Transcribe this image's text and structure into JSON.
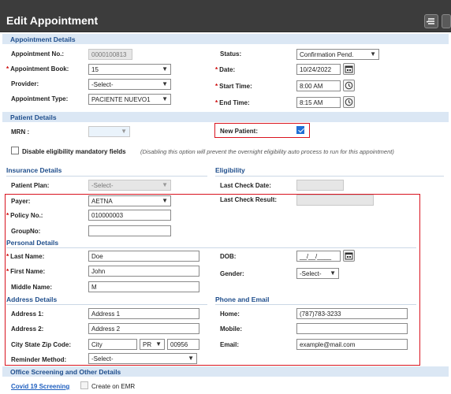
{
  "window": {
    "title": "Edit Appointment"
  },
  "sections": {
    "appointment_details": "Appointment Details",
    "patient_details": "Patient Details",
    "office_screening": "Office Screening and Other Details"
  },
  "appointment": {
    "appointment_no_label": "Appointment No.:",
    "appointment_no_value": "0000100813",
    "book_label": "Appointment Book:",
    "book_value": "15",
    "provider_label": "Provider:",
    "provider_value": "-Select-",
    "type_label": "Appointment Type:",
    "type_value": "PACIENTE NUEVO1",
    "status_label": "Status:",
    "status_value": "Confirmation Pend.",
    "date_label": "Date:",
    "date_value": "10/24/2022",
    "start_label": "Start Time:",
    "start_value": "8:00 AM",
    "end_label": "End Time:",
    "end_value": "8:15 AM"
  },
  "patient": {
    "mrn_label": "MRN :",
    "new_patient_label": "New Patient:",
    "new_patient_checked": true,
    "disable_elig_label": "Disable eligibility mandatory fields",
    "disable_elig_note": "(Disabling this option will prevent the overnight eligibility auto process to run for this appointment)"
  },
  "insurance": {
    "heading": "Insurance Details",
    "plan_label": "Patient Plan:",
    "plan_value": "-Select-",
    "payer_label": "Payer:",
    "payer_value": "AETNA",
    "policy_label": "Policy No.:",
    "policy_value": "010000003",
    "group_label": "GroupNo:",
    "group_value": ""
  },
  "eligibility": {
    "heading": "Eligibility",
    "last_check_date_label": "Last Check Date:",
    "last_check_result_label": "Last Check Result:"
  },
  "personal": {
    "heading": "Personal Details",
    "last_name_label": "Last Name:",
    "last_name_value": "Doe",
    "first_name_label": "First Name:",
    "first_name_value": "John",
    "middle_name_label": "Middle Name:",
    "middle_name_value": "M",
    "dob_label": "DOB:",
    "dob_value": "__/__/____",
    "gender_label": "Gender:",
    "gender_value": "-Select-"
  },
  "address": {
    "heading": "Address Details",
    "address1_label": "Address 1:",
    "address1_value": "Address 1",
    "address2_label": "Address 2:",
    "address2_value": "Address 2",
    "csz_label": "City State Zip Code:",
    "city_value": "City",
    "state_value": "PR",
    "zip_value": "00956",
    "reminder_label": "Reminder Method:",
    "reminder_value": "-Select-"
  },
  "contact": {
    "heading": "Phone and Email",
    "home_label": "Home:",
    "home_value": "(787)783-3233",
    "mobile_label": "Mobile:",
    "mobile_value": "",
    "email_label": "Email:",
    "email_value": "example@mail.com"
  },
  "screening": {
    "covid_link": "Covid 19 Screening",
    "create_emr_label": "Create on EMR"
  },
  "colors": {
    "section_bg": "#dbe7f4",
    "section_text": "#1f4e8c",
    "highlight_border": "#d9141f",
    "titlebar_bg": "#3c3c3c"
  }
}
